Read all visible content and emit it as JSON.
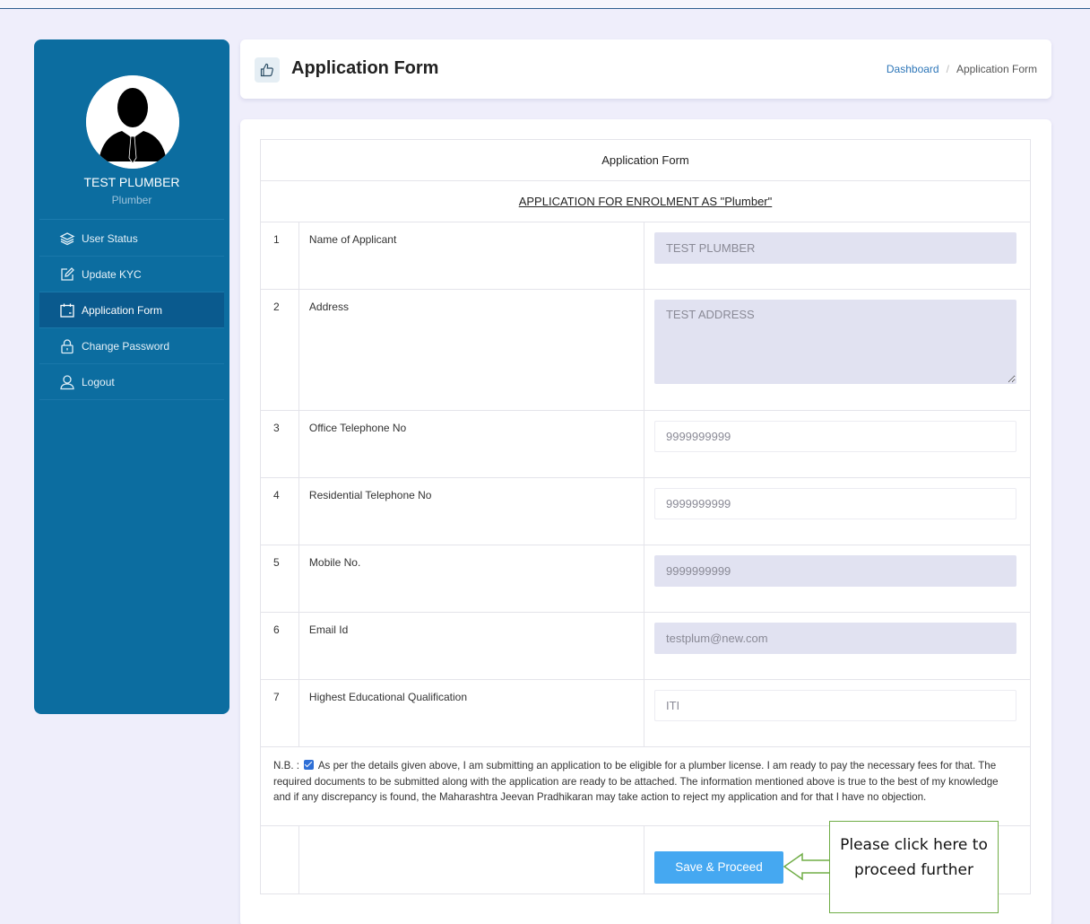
{
  "profile": {
    "name": "TEST PLUMBER",
    "role": "Plumber"
  },
  "sidebar": {
    "items": [
      {
        "label": "User Status",
        "icon": "layers-icon",
        "active": false
      },
      {
        "label": "Update KYC",
        "icon": "edit-icon",
        "active": false
      },
      {
        "label": "Application Form",
        "icon": "calendar-icon",
        "active": true
      },
      {
        "label": "Change Password",
        "icon": "lock-icon",
        "active": false
      },
      {
        "label": "Logout",
        "icon": "user-icon",
        "active": false
      }
    ]
  },
  "header": {
    "title": "Application Form",
    "breadcrumb": {
      "home": "Dashboard",
      "separator": "/",
      "current": "Application Form"
    }
  },
  "form": {
    "heading": "Application Form",
    "subheading": "APPLICATION FOR ENROLMENT AS \"Plumber\"",
    "rows": [
      {
        "num": "1",
        "label": "Name of Applicant",
        "value": "TEST PLUMBER",
        "readonly": true
      },
      {
        "num": "2",
        "label": "Address",
        "value": "TEST ADDRESS",
        "readonly": true
      },
      {
        "num": "3",
        "label": "Office Telephone No",
        "value": "9999999999",
        "readonly": false
      },
      {
        "num": "4",
        "label": "Residential Telephone No",
        "value": "9999999999",
        "readonly": false
      },
      {
        "num": "5",
        "label": "Mobile No.",
        "value": "9999999999",
        "readonly": true
      },
      {
        "num": "6",
        "label": "Email Id",
        "value": "testplum@new.com",
        "readonly": true
      },
      {
        "num": "7",
        "label": "Highest Educational Qualification",
        "value": "ITI",
        "readonly": false
      }
    ],
    "note_prefix": "N.B. :",
    "declaration_checked": true,
    "note_text": "As per the details given above, I am submitting an application to be eligible for a plumber license. I am ready to pay the necessary fees for that. The required documents to be submitted along with the application are ready to be attached. The information mentioned above is true to the best of my knowledge and if any discrepancy is found, the Maharashtra Jeevan Pradhikaran may take action to reject my application and for that I have no objection.",
    "save_label": "Save & Proceed"
  },
  "callout": {
    "text": "Please click here to proceed further"
  },
  "colors": {
    "sidebar": "#0c6da0",
    "sidebar_active": "#0a5a8e",
    "page_bg": "#efeefb",
    "button": "#45a8f1",
    "readonly_field": "#e1e2f1",
    "callout_border": "#70ad47"
  }
}
